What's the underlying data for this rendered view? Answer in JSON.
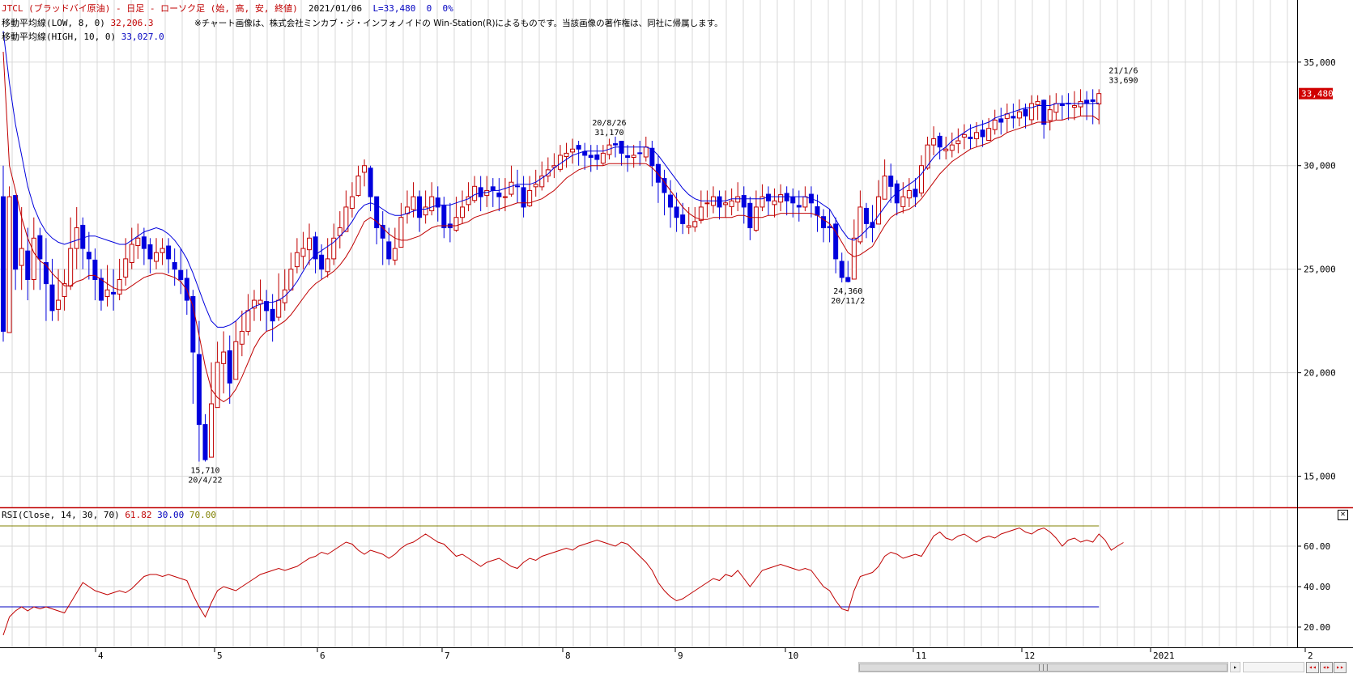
{
  "header": {
    "title": "JTCL (ブラッドバイ原油) - 日足 - ローソク足 (始, 高, 安, 終値)",
    "date": "2021/01/06",
    "last": "L=33,480",
    "change": "0",
    "change_pct": "0%",
    "ma_low_label": "移動平均線(LOW, 8, 0)",
    "ma_low_value": "32,206.3",
    "ma_high_label": "移動平均線(HIGH, 10, 0)",
    "ma_high_value": "33,027.0",
    "copyright": "※チャート画像は、株式会社ミンカブ・ジ・インフォノイドの Win-Station(R)によるものです。当該画像の著作権は、同社に帰属します。"
  },
  "rsi_header": {
    "label": "RSI(Close, 14, 30, 70)",
    "value": "61.82",
    "lower": "30.00",
    "upper": "70.00"
  },
  "colors": {
    "up": "#c00000",
    "down": "#0000dd",
    "ma_low": "#c00000",
    "ma_high": "#0000dd",
    "rsi": "#c00000",
    "rsi_upper": "#808000",
    "rsi_lower": "#0000c0",
    "grid": "#d8d8d8",
    "pane_border": "#c00000"
  },
  "chart_data": [
    {
      "type": "candlestick",
      "title": "JTCL (ブラッドバイ原油) - 日足 - ローソク足 (始, 高, 安, 終値)",
      "ylim": [
        13500,
        38000
      ],
      "y_ticks": [
        15000,
        20000,
        25000,
        30000,
        35000
      ],
      "y_tick_labels": [
        "15,000",
        "20,000",
        "25,000",
        "30,000",
        "35,000"
      ],
      "x_tick_labels": [
        "4",
        "5",
        "6",
        "7",
        "8",
        "9",
        "10",
        "11",
        "12",
        "2021",
        "2"
      ],
      "last_price_label": "33,480",
      "closes": [
        22000,
        28500,
        25000,
        26000,
        24500,
        26500,
        25500,
        24300,
        23000,
        23500,
        24300,
        26000,
        27000,
        26000,
        25500,
        24500,
        23500,
        24000,
        23800,
        24500,
        25500,
        26200,
        26500,
        26000,
        25500,
        25800,
        26000,
        25500,
        25000,
        24500,
        23500,
        21000,
        17500,
        15800,
        18500,
        20500,
        21000,
        19500,
        21500,
        22000,
        23000,
        23500,
        23500,
        23000,
        22500,
        23500,
        24000,
        25000,
        25800,
        26000,
        26500,
        25500,
        25000,
        25500,
        26500,
        27000,
        28000,
        28500,
        29500,
        30000,
        28500,
        27000,
        26500,
        25500,
        26000,
        27500,
        28000,
        28500,
        27500,
        28000,
        28500,
        28000,
        27000,
        27000,
        27500,
        28000,
        28500,
        29000,
        28500,
        28800,
        28800,
        28500,
        28500,
        29200,
        29000,
        28000,
        28800,
        29100,
        29500,
        29800,
        30000,
        30500,
        30600,
        30800,
        30800,
        30500,
        30400,
        30300,
        30600,
        31000,
        31000,
        30600,
        30400,
        30500,
        30600,
        30900,
        30000,
        29200,
        28700,
        28000,
        27500,
        27200,
        27100,
        27300,
        28000,
        28200,
        28500,
        28000,
        28200,
        28300,
        28500,
        28000,
        27000,
        28000,
        28500,
        28300,
        28300,
        28600,
        28300,
        28200,
        28000,
        28500,
        28200,
        27600,
        27000,
        27000,
        25500,
        24600,
        24400,
        26500,
        28000,
        27200,
        27000,
        28500,
        29500,
        29000,
        28200,
        28500,
        28800,
        28500,
        30000,
        31000,
        31300,
        30900,
        30800,
        31000,
        31200,
        31500,
        31300,
        31600,
        31400,
        31800,
        32200,
        32100,
        32500,
        32300,
        32600,
        32400,
        33000,
        33100,
        32000,
        32700,
        33000,
        32900,
        33000,
        32900,
        33100,
        33000,
        33100,
        33480
      ],
      "highs": [
        30000,
        29000,
        28000,
        28000,
        27000,
        27500,
        27000,
        26500,
        25500,
        25000,
        25000,
        27500,
        28000,
        27500,
        26800,
        26000,
        25000,
        25200,
        25000,
        25500,
        26500,
        27000,
        27200,
        27000,
        26500,
        26500,
        26500,
        26500,
        26000,
        26000,
        25000,
        24000,
        22500,
        18000,
        20500,
        21500,
        22000,
        21800,
        22500,
        23000,
        23800,
        24000,
        24500,
        24000,
        23800,
        24800,
        25000,
        25800,
        26500,
        26800,
        27200,
        26800,
        26200,
        26500,
        27200,
        27800,
        28800,
        29200,
        30000,
        30300,
        30000,
        28500,
        27800,
        27000,
        27000,
        28200,
        28800,
        29200,
        28800,
        28800,
        29200,
        29000,
        28500,
        28200,
        28500,
        28800,
        29200,
        29500,
        29500,
        29500,
        29400,
        29400,
        29400,
        30000,
        29800,
        29500,
        29500,
        29800,
        30200,
        30400,
        30600,
        31000,
        31100,
        31300,
        31200,
        31100,
        31000,
        31000,
        31000,
        31300,
        31400,
        31200,
        31000,
        31000,
        31200,
        31400,
        31200,
        30500,
        29800,
        29300,
        28700,
        28200,
        28000,
        28000,
        28800,
        28800,
        29000,
        28800,
        28800,
        28900,
        29200,
        29000,
        28500,
        28800,
        29100,
        29000,
        28900,
        29100,
        29000,
        28900,
        28800,
        29000,
        29000,
        28600,
        27900,
        27900,
        27500,
        25800,
        25400,
        27400,
        28800,
        28200,
        28100,
        29300,
        30300,
        30100,
        29300,
        29200,
        29400,
        29400,
        30500,
        31400,
        31900,
        31600,
        31400,
        31600,
        31800,
        32000,
        32000,
        32100,
        32200,
        32300,
        32700,
        32800,
        33000,
        33000,
        33200,
        33000,
        33400,
        33400,
        33200,
        33400,
        33500,
        33400,
        33500,
        33600,
        33690,
        33600,
        33690,
        33690
      ],
      "lows": [
        21500,
        24500,
        24000,
        24000,
        23500,
        24000,
        24000,
        22500,
        22500,
        22500,
        23000,
        24000,
        25000,
        25000,
        24500,
        23500,
        23000,
        23200,
        23000,
        23500,
        24200,
        25000,
        25500,
        25200,
        24800,
        25000,
        25200,
        24800,
        24200,
        23800,
        22800,
        18500,
        15710,
        15710,
        16000,
        18500,
        19000,
        18500,
        20000,
        20800,
        21800,
        22500,
        22500,
        22000,
        21500,
        22500,
        23000,
        24000,
        24800,
        25000,
        25200,
        24800,
        24500,
        24600,
        25200,
        26000,
        26800,
        27500,
        28500,
        29000,
        27800,
        26200,
        25200,
        25200,
        25200,
        26800,
        27200,
        27500,
        26800,
        27200,
        27600,
        27300,
        26500,
        26300,
        26800,
        27200,
        27800,
        28200,
        27800,
        28000,
        28000,
        27800,
        27800,
        28500,
        28200,
        27500,
        28000,
        28500,
        28800,
        29200,
        29400,
        29700,
        29900,
        30100,
        30000,
        29800,
        29700,
        29800,
        30000,
        30300,
        30400,
        30000,
        29700,
        29900,
        30000,
        30200,
        29000,
        28200,
        27600,
        27000,
        26800,
        26700,
        26700,
        26800,
        27200,
        27500,
        27700,
        27400,
        27500,
        27600,
        27800,
        27200,
        26400,
        26800,
        27800,
        27600,
        27500,
        27800,
        27600,
        27500,
        27300,
        27800,
        27500,
        26800,
        26300,
        26300,
        24800,
        24360,
        24360,
        24800,
        26200,
        26500,
        26300,
        27200,
        28600,
        28200,
        27600,
        27700,
        28000,
        28000,
        28500,
        29800,
        30500,
        30300,
        30300,
        30400,
        30600,
        30800,
        30800,
        30900,
        30900,
        31200,
        31500,
        31500,
        31600,
        31800,
        31900,
        31800,
        32000,
        32200,
        31300,
        31700,
        32200,
        32200,
        32200,
        32200,
        32400,
        32200,
        32000,
        32000
      ],
      "ma_low": [
        35500,
        30000,
        28800,
        27500,
        26500,
        25800,
        25400,
        25200,
        24800,
        24500,
        24200,
        24200,
        24400,
        24500,
        24700,
        24700,
        24500,
        24300,
        24100,
        24000,
        24000,
        24200,
        24400,
        24600,
        24700,
        24800,
        24800,
        24700,
        24600,
        24400,
        24000,
        23200,
        21800,
        20300,
        19200,
        18800,
        18600,
        18800,
        19200,
        19800,
        20500,
        21200,
        21700,
        22000,
        22100,
        22300,
        22500,
        22800,
        23200,
        23600,
        24000,
        24300,
        24500,
        24700,
        24900,
        25200,
        25600,
        26100,
        26700,
        27300,
        27500,
        27300,
        27000,
        26700,
        26500,
        26400,
        26400,
        26500,
        26600,
        26800,
        27000,
        27100,
        27100,
        27100,
        27100,
        27200,
        27300,
        27500,
        27600,
        27700,
        27800,
        27900,
        28000,
        28100,
        28200,
        28200,
        28200,
        28300,
        28400,
        28600,
        28800,
        29100,
        29400,
        29600,
        29800,
        29900,
        30000,
        30000,
        30000,
        30100,
        30100,
        30100,
        30100,
        30100,
        30100,
        30100,
        29900,
        29600,
        29200,
        28800,
        28400,
        28000,
        27700,
        27500,
        27400,
        27400,
        27500,
        27500,
        27500,
        27500,
        27600,
        27600,
        27500,
        27500,
        27500,
        27600,
        27600,
        27700,
        27700,
        27700,
        27700,
        27700,
        27700,
        27600,
        27400,
        27200,
        26800,
        26300,
        25800,
        25600,
        25700,
        25900,
        26100,
        26600,
        27100,
        27500,
        27700,
        27800,
        27900,
        28100,
        28400,
        28800,
        29200,
        29600,
        29900,
        30200,
        30400,
        30600,
        30800,
        30900,
        31000,
        31100,
        31300,
        31400,
        31600,
        31700,
        31800,
        31900,
        32000,
        32100,
        32100,
        32100,
        32200,
        32200,
        32300,
        32300,
        32400,
        32400,
        32400,
        32206
      ],
      "ma_high": [
        36500,
        34000,
        32000,
        30500,
        29000,
        28000,
        27300,
        26800,
        26500,
        26300,
        26200,
        26300,
        26400,
        26500,
        26600,
        26600,
        26500,
        26400,
        26300,
        26200,
        26200,
        26400,
        26600,
        26800,
        26900,
        27000,
        26900,
        26700,
        26400,
        26000,
        25500,
        24800,
        24000,
        23200,
        22500,
        22200,
        22200,
        22300,
        22500,
        22800,
        23000,
        23200,
        23300,
        23400,
        23400,
        23500,
        23700,
        24000,
        24400,
        24900,
        25400,
        25700,
        25900,
        26100,
        26300,
        26600,
        26900,
        27300,
        27800,
        28100,
        28200,
        28100,
        27900,
        27700,
        27600,
        27600,
        27700,
        27800,
        27900,
        27900,
        28000,
        28100,
        28100,
        28100,
        28200,
        28300,
        28400,
        28600,
        28700,
        28700,
        28800,
        28800,
        28900,
        29000,
        29100,
        29100,
        29100,
        29200,
        29400,
        29600,
        29900,
        30100,
        30300,
        30500,
        30600,
        30700,
        30700,
        30700,
        30700,
        30800,
        30900,
        30900,
        30900,
        30900,
        30900,
        30900,
        30800,
        30500,
        30100,
        29700,
        29300,
        28900,
        28600,
        28400,
        28300,
        28300,
        28300,
        28300,
        28300,
        28400,
        28400,
        28400,
        28400,
        28400,
        28400,
        28500,
        28500,
        28500,
        28500,
        28500,
        28500,
        28500,
        28400,
        28300,
        28100,
        27900,
        27400,
        26900,
        26500,
        26400,
        26600,
        26900,
        27200,
        27600,
        28000,
        28400,
        28700,
        28900,
        29100,
        29300,
        29600,
        30000,
        30400,
        30700,
        30900,
        31200,
        31400,
        31600,
        31800,
        31900,
        32000,
        32100,
        32300,
        32400,
        32500,
        32600,
        32700,
        32800,
        32800,
        32900,
        32900,
        32900,
        33000,
        33000,
        33000,
        33000,
        33000,
        33000,
        33000,
        33027
      ],
      "annotations": [
        {
          "label": "15,710",
          "date": "20/4/22",
          "value": 15710,
          "index": 33,
          "position": "below"
        },
        {
          "label": "20/8/26",
          "value_label": "31,170",
          "value": 31170,
          "index": 99,
          "position": "above"
        },
        {
          "label": "24,360",
          "date": "20/11/2",
          "value": 24360,
          "index": 138,
          "position": "below"
        },
        {
          "label": "21/1/6",
          "value_label": "33,690",
          "value": 33690,
          "index": 183,
          "position": "above"
        }
      ]
    },
    {
      "type": "line",
      "title": "RSI(Close, 14, 30, 70)",
      "ylim": [
        10,
        78
      ],
      "y_ticks": [
        20,
        40,
        60
      ],
      "y_tick_labels": [
        "20.00",
        "40.00",
        "60.00"
      ],
      "upper_line": 70,
      "lower_line": 30,
      "values": [
        16,
        25,
        28,
        30,
        28,
        30,
        29,
        30,
        29,
        28,
        27,
        32,
        37,
        42,
        40,
        38,
        37,
        36,
        37,
        38,
        37,
        39,
        42,
        45,
        46,
        46,
        45,
        46,
        45,
        44,
        43,
        36,
        30,
        25,
        32,
        38,
        40,
        39,
        38,
        40,
        42,
        44,
        46,
        47,
        48,
        49,
        48,
        49,
        50,
        52,
        54,
        55,
        57,
        56,
        58,
        60,
        62,
        61,
        58,
        56,
        58,
        57,
        56,
        54,
        56,
        59,
        61,
        62,
        64,
        66,
        64,
        62,
        61,
        58,
        55,
        56,
        54,
        52,
        50,
        52,
        53,
        54,
        52,
        50,
        49,
        52,
        54,
        53,
        55,
        56,
        57,
        58,
        59,
        58,
        60,
        61,
        62,
        63,
        62,
        61,
        60,
        62,
        61,
        58,
        55,
        52,
        48,
        42,
        38,
        35,
        33,
        34,
        36,
        38,
        40,
        42,
        44,
        43,
        46,
        45,
        48,
        44,
        40,
        44,
        48,
        49,
        50,
        51,
        50,
        49,
        48,
        49,
        48,
        44,
        40,
        38,
        33,
        29,
        28,
        38,
        45,
        46,
        47,
        50,
        55,
        57,
        56,
        54,
        55,
        56,
        55,
        60,
        65,
        67,
        64,
        63,
        65,
        66,
        64,
        62,
        64,
        65,
        64,
        66,
        67,
        68,
        69,
        67,
        66,
        68,
        69,
        67,
        64,
        60,
        63,
        64,
        62,
        63,
        62,
        66,
        63,
        58,
        60,
        61.82
      ]
    }
  ]
}
